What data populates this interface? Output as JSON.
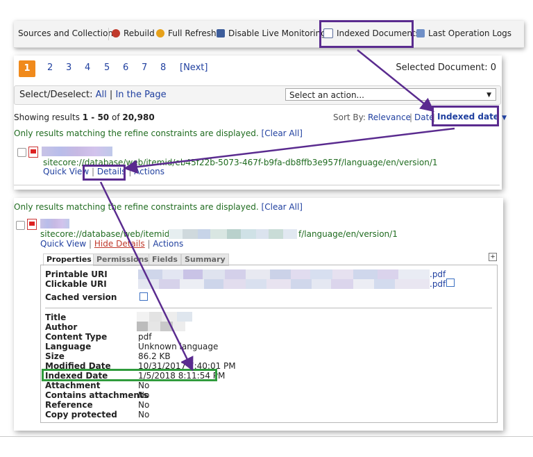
{
  "toolbar": {
    "items": [
      {
        "label": "Sources and Collections",
        "icon": "sources-icon"
      },
      {
        "label": "Rebuild",
        "icon": "rebuild-icon"
      },
      {
        "label": "Full Refresh",
        "icon": "refresh-icon"
      },
      {
        "label": "Disable Live Monitoring",
        "icon": "monitor-icon"
      },
      {
        "label": "Indexed Documents",
        "icon": "document-icon"
      },
      {
        "label": "Last Operation Logs",
        "icon": "log-icon"
      }
    ]
  },
  "pagination": {
    "pages": [
      "1",
      "2",
      "3",
      "4",
      "5",
      "6",
      "7",
      "8"
    ],
    "active": "1",
    "next": "[Next]",
    "selected_document": "Selected Document: 0"
  },
  "select_bar": {
    "label": "Select/Deselect:",
    "all": "All",
    "divider": "|",
    "in_page": "In the Page",
    "action_placeholder": "Select an action..."
  },
  "results_info": {
    "prefix": "Showing results ",
    "range": "1 - 50",
    "of": " of ",
    "total": "20,980",
    "sort_by": "Sort By:",
    "sort_options": [
      "Relevance",
      "Date",
      "Indexed date"
    ]
  },
  "refine": {
    "text": "Only results matching the refine constraints are displayed.",
    "clear_all": "[Clear All]"
  },
  "result_item": {
    "url": "sitecore://database/web/itemid/eb45f22b-5073-467f-b9fa-db8ffb3e957f/language/en/version/1",
    "actions": [
      "Quick View",
      "Details",
      "Actions"
    ]
  },
  "detail": {
    "refine_text": "Only results matching the refine constraints are displayed.",
    "clear_all": "[Clear All]",
    "url_prefix": "sitecore://database/web/itemid/",
    "url_suffix": "f/language/en/version/1",
    "actions": [
      "Quick View",
      "Hide Details",
      "Actions"
    ],
    "tabs": [
      "Properties",
      "Permissions",
      "Fields",
      "Summary"
    ],
    "expand_symbol": "+",
    "uris": [
      {
        "label": "Printable URI",
        "value": ".pdf"
      },
      {
        "label": "Clickable URI",
        "value": ".pdf"
      },
      {
        "label": "Cached version",
        "value": ""
      }
    ],
    "properties": [
      {
        "label": "Title",
        "value": ""
      },
      {
        "label": "Author",
        "value": ""
      },
      {
        "label": "Content Type",
        "value": "pdf"
      },
      {
        "label": "Language",
        "value": "Unknown language"
      },
      {
        "label": "Size",
        "value": "86.2 KB"
      },
      {
        "label": "Modified Date",
        "value": "10/31/2017 7:40:01 PM"
      },
      {
        "label": "Indexed Date",
        "value": "1/5/2018 8:11:54 PM"
      },
      {
        "label": "Attachment",
        "value": "No"
      },
      {
        "label": "Contains attachments",
        "value": "No"
      },
      {
        "label": "Reference",
        "value": "No"
      },
      {
        "label": "Copy protected",
        "value": "No"
      }
    ]
  },
  "colors": {
    "accent_orange": "#f08a1c",
    "link_blue": "#1f3f9f",
    "url_green": "#1f6b1f",
    "annotation_purple": "#5a2b8f",
    "annotation_green": "#2f9b3c"
  }
}
